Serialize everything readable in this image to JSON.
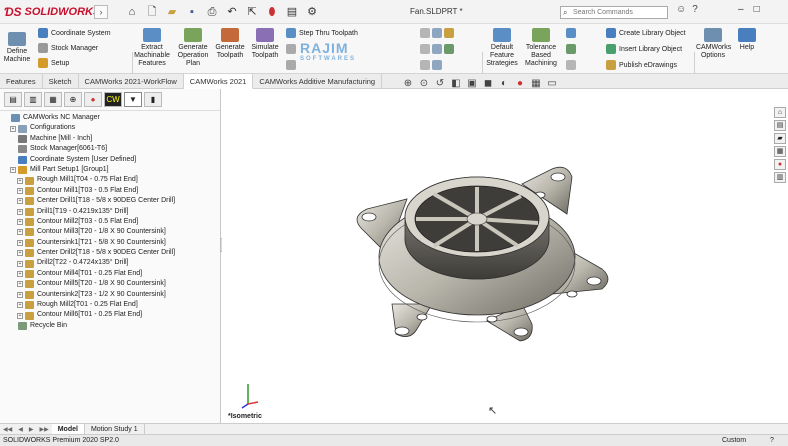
{
  "app": {
    "logo_text": "SOLIDWORKS",
    "doc_title": "Fan.SLDPRT *"
  },
  "search": {
    "placeholder": "Search Commands"
  },
  "ribbon": {
    "define_machine": "Define Machine",
    "coordinate_system": "Coordinate System",
    "stock_manager": "Stock Manager",
    "setup": "Setup",
    "extract_features": "Extract Machinable Features",
    "generate_operation_plan": "Generate Operation Plan",
    "generate_toolpath": "Generate Toolpath",
    "simulate_toolpath": "Simulate Toolpath",
    "step_thru_toolpath": "Step Thru Toolpath",
    "default_strategies": "Default Feature Strategies",
    "tolerance_machining": "Tolerance Based Machining",
    "create_library": "Create Library Object",
    "insert_library": "Insert Library Object",
    "publish_edrawings": "Publish eDrawings",
    "camworks_options": "CAMWorks Options",
    "help": "Help"
  },
  "watermark": {
    "text": "RAJIM",
    "sub": "SOFTWARES"
  },
  "tabs": [
    "Features",
    "Sketch",
    "CAMWorks 2021-WorkFlow",
    "CAMWorks 2021",
    "CAMWorks Additive Manufacturing"
  ],
  "active_tab": "CAMWorks 2021",
  "tree": [
    {
      "label": "CAMWorks NC Manager",
      "level": 0,
      "expander": false,
      "color": "#6b8fb5"
    },
    {
      "label": "Configurations",
      "level": 1,
      "expander": true,
      "color": "#8aa0b8"
    },
    {
      "label": "Machine [Mill - Inch]",
      "level": 1,
      "expander": false,
      "color": "#777777"
    },
    {
      "label": "Stock Manager[6061-T6]",
      "level": 1,
      "expander": false,
      "color": "#888888"
    },
    {
      "label": "Coordinate System [User Defined]",
      "level": 1,
      "expander": false,
      "color": "#4a7fbf"
    },
    {
      "label": "Mill Part Setup1 [Group1]",
      "level": 1,
      "expander": true,
      "color": "#d49a2a"
    },
    {
      "label": "Rough Mill1[T04 - 0.75 Flat End]",
      "level": 2,
      "expander": true,
      "color": "#c9a040"
    },
    {
      "label": "Contour Mill1[T03 - 0.5 Flat End]",
      "level": 2,
      "expander": true,
      "color": "#c9a040"
    },
    {
      "label": "Center Drill1[T18 - 5/8 x 90DEG Center Drill]",
      "level": 2,
      "expander": true,
      "color": "#c9a040"
    },
    {
      "label": "Drill1[T19 - 0.4219x135° Drill]",
      "level": 2,
      "expander": true,
      "color": "#c9a040"
    },
    {
      "label": "Contour Mill2[T03 - 0.5 Flat End]",
      "level": 2,
      "expander": true,
      "color": "#c9a040"
    },
    {
      "label": "Contour Mill3[T20 - 1/8 X 90 Countersink]",
      "level": 2,
      "expander": true,
      "color": "#c9a040"
    },
    {
      "label": "Countersink1[T21 - 5/8 X 90 Countersink]",
      "level": 2,
      "expander": true,
      "color": "#c9a040"
    },
    {
      "label": "Center Drill2[T18 - 5/8 x 90DEG Center Drill]",
      "level": 2,
      "expander": true,
      "color": "#c9a040"
    },
    {
      "label": "Drill2[T22 - 0.4724x135° Drill]",
      "level": 2,
      "expander": true,
      "color": "#c9a040"
    },
    {
      "label": "Contour Mill4[T01 - 0.25 Flat End]",
      "level": 2,
      "expander": true,
      "color": "#c9a040"
    },
    {
      "label": "Contour Mill5[T20 - 1/8 X 90 Countersink]",
      "level": 2,
      "expander": true,
      "color": "#c9a040"
    },
    {
      "label": "Countersink2[T23 - 1/2 X 90 Countersink]",
      "level": 2,
      "expander": true,
      "color": "#c9a040"
    },
    {
      "label": "Rough Mill2[T01 - 0.25 Flat End]",
      "level": 2,
      "expander": true,
      "color": "#c9a040"
    },
    {
      "label": "Contour Mill6[T01 - 0.25 Flat End]",
      "level": 2,
      "expander": true,
      "color": "#c9a040"
    },
    {
      "label": "Recycle Bin",
      "level": 1,
      "expander": false,
      "color": "#7a9a7a"
    }
  ],
  "viewport": {
    "view_label": "*Isometric"
  },
  "bottom_tabs": [
    "Model",
    "Motion Study 1"
  ],
  "status": {
    "text": "SOLIDWORKS Premium 2020 SP2.0",
    "units": "Custom",
    "help": "?"
  }
}
